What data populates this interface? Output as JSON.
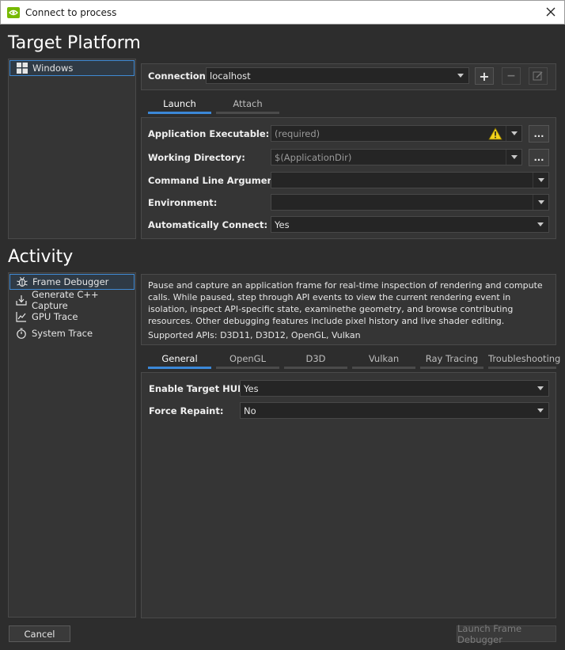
{
  "window": {
    "title": "Connect to process"
  },
  "sections": {
    "target_platform": "Target Platform",
    "activity": "Activity"
  },
  "platforms": [
    {
      "label": "Windows",
      "selected": true
    }
  ],
  "connection": {
    "label": "Connection:",
    "value": "localhost",
    "add_label": "+",
    "remove_label": "−"
  },
  "launch_tabs": [
    {
      "label": "Launch",
      "active": true
    },
    {
      "label": "Attach",
      "active": false
    }
  ],
  "launch_fields": {
    "app_exe": {
      "label": "Application Executable:",
      "placeholder": "(required)",
      "browse": "..."
    },
    "work_dir": {
      "label": "Working Directory:",
      "value": "$(ApplicationDir)",
      "browse": "..."
    },
    "cmd_args": {
      "label": "Command Line Arguments:",
      "value": ""
    },
    "environment": {
      "label": "Environment:",
      "value": ""
    },
    "auto_connect": {
      "label": "Automatically Connect:",
      "value": "Yes"
    }
  },
  "activities": [
    {
      "label": "Frame Debugger",
      "icon": "bug-icon",
      "selected": true
    },
    {
      "label": "Generate C++ Capture",
      "icon": "export-icon",
      "selected": false
    },
    {
      "label": "GPU Trace",
      "icon": "chart-icon",
      "selected": false
    },
    {
      "label": "System Trace",
      "icon": "stopwatch-icon",
      "selected": false
    }
  ],
  "description": "Pause and capture an application frame for real-time inspection of rendering and compute calls. While paused, step through API events to view the current rendering event in isolation, inspect API-specific state, examinethe geometry, and browse contributing resources. Other debugging features include pixel history and live shader editing.",
  "supported_apis": "Supported APIs: D3D11, D3D12, OpenGL, Vulkan",
  "options_tabs": [
    {
      "label": "General",
      "active": true
    },
    {
      "label": "OpenGL",
      "active": false
    },
    {
      "label": "D3D",
      "active": false
    },
    {
      "label": "Vulkan",
      "active": false
    },
    {
      "label": "Ray Tracing",
      "active": false
    },
    {
      "label": "Troubleshooting",
      "active": false
    }
  ],
  "general_options": {
    "target_hud": {
      "label": "Enable Target HUD:",
      "value": "Yes"
    },
    "force_repaint": {
      "label": "Force Repaint:",
      "value": "No"
    }
  },
  "footer": {
    "cancel": "Cancel",
    "launch": "Launch Frame Debugger"
  },
  "colors": {
    "accent": "#3b88d8",
    "background": "#2d2d2d",
    "brand": "#76b900",
    "warning": "#f2d21b"
  }
}
